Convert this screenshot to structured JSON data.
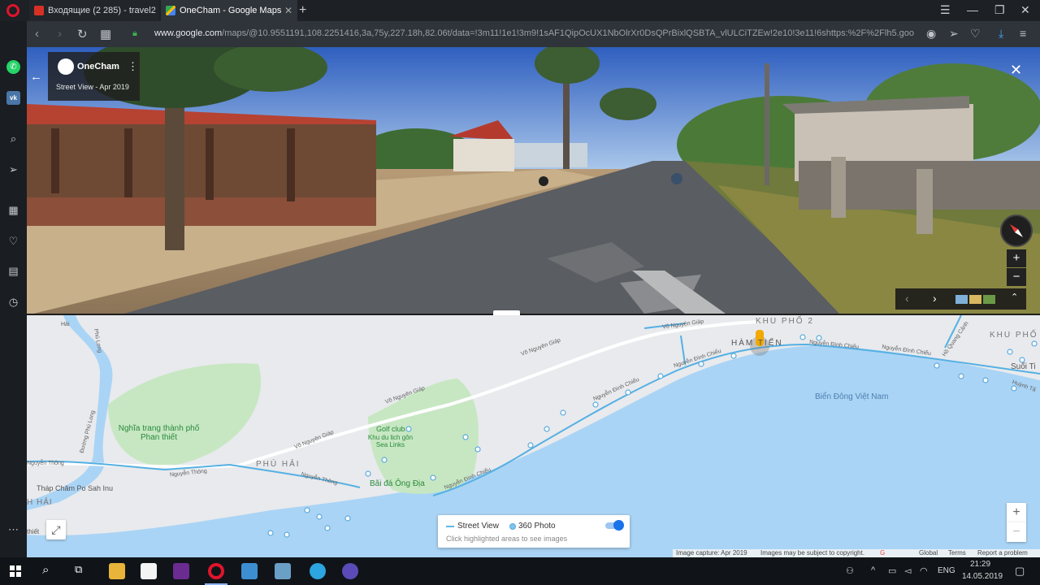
{
  "browser": {
    "tabs": [
      {
        "title": "Входящие (2 285) - travel2",
        "active": false
      },
      {
        "title": "OneCham - Google Maps",
        "active": true
      }
    ],
    "url_host": "www.google.com",
    "url_path": "/maps/@10.9551191,108.2251416,3a,75y,227.18h,82.06t/data=!3m11!1e1!3m9!1sAF1QipOcUX1NbOlrXr0DsQPrBixlQSBTA_vlULCiTZEw!2e10!3e11!6shttps:%2F%2Flh5.googleuserco"
  },
  "street_view": {
    "place_name": "OneCham",
    "subtitle": "Street View - Apr 2019"
  },
  "map": {
    "areas": [
      "KHU PHỐ 2",
      "HÀM TIẾN",
      "KHU PHỐ",
      "PHÚ HẢI",
      "H HẢI"
    ],
    "roads": [
      "Võ Nguyên Giáp",
      "Võ Nguyên Giáp",
      "Võ Nguyên Giáp",
      "Võ Nguyên Giáp",
      "Nguyễn Đình Chiểu",
      "Nguyễn Đình Chiểu",
      "Nguyễn Đình Chiểu",
      "Nguyễn Đình Chiểu",
      "Nguyễn Đình Chiểu",
      "Nguyễn Thông",
      "Nguyễn Thông",
      "Nguyễn Thông",
      "Phú Long",
      "Đường Phú Long",
      "Hồ Quang Cảnh",
      "Huỳnh Tấ",
      "Hải"
    ],
    "places": {
      "cemetery": "Nghĩa trang thành phố Phan thiết",
      "golf_name": "Golf club",
      "golf_sub": "Khu du lịch gôn Sea Links",
      "beach": "Bãi đá Ông Địa",
      "tower": "Tháp Chăm Po Sah Inu",
      "sea": "Biển Đông Việt Nam",
      "suoi": "Suối Ti",
      "thiet": "thiết"
    },
    "legend": {
      "street_view": "Street View",
      "photo360": "360 Photo",
      "hint": "Click highlighted areas to see images"
    },
    "footer": {
      "capture": "Image capture: Apr 2019",
      "copyright": "Images may be subject to copyright.",
      "global": "Global",
      "terms": "Terms",
      "report": "Report a problem"
    }
  },
  "taskbar": {
    "lang": "ENG",
    "time": "21:29",
    "date": "14.05.2019"
  }
}
